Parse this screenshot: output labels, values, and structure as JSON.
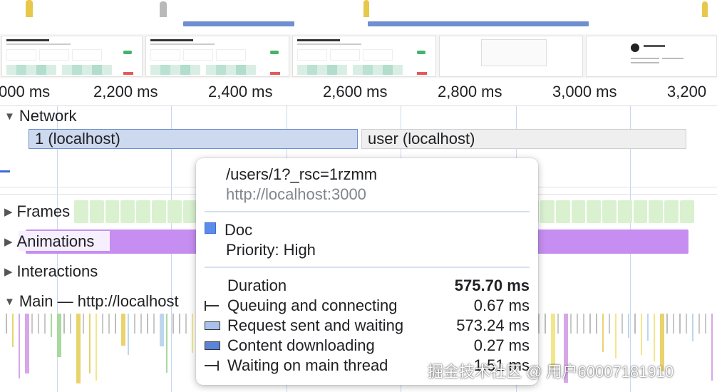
{
  "ruler": {
    "ticks": [
      "000 ms",
      "2,200 ms",
      "2,400 ms",
      "2,600 ms",
      "2,800 ms",
      "3,000 ms",
      "3,200"
    ]
  },
  "tracks": {
    "network": "Network",
    "frames": "Frames",
    "animations": "Animations",
    "interactions": "Interactions",
    "main": "Main — http://localhost"
  },
  "network_requests": [
    {
      "label": "1 (localhost)"
    },
    {
      "label": "user (localhost)"
    }
  ],
  "tooltip": {
    "url_path": "/users/1?_rsc=1rzmm",
    "origin": "http://localhost:3000",
    "resource_type": "Doc",
    "priority": "Priority: High",
    "duration_label": "Duration",
    "duration_value": "575.70 ms",
    "phases": [
      {
        "icon": "queuing-icon",
        "label": "Queuing and connecting",
        "value": "0.67 ms"
      },
      {
        "icon": "request-waiting-icon",
        "label": "Request sent and waiting",
        "value": "573.24 ms"
      },
      {
        "icon": "content-download-icon",
        "label": "Content downloading",
        "value": "0.27 ms"
      },
      {
        "icon": "main-thread-wait-icon",
        "label": "Waiting on main thread",
        "value": "1.51 ms"
      }
    ]
  },
  "watermark": "掘金技术社区 @ 用户60007181910",
  "colors": {
    "network_bar_selected": "#cdd9ee",
    "network_bar_border": "#6e8fd0",
    "doc_swatch": "#5b8ce8",
    "frames": "#d9f1cf",
    "animations": "#c58ef0"
  }
}
